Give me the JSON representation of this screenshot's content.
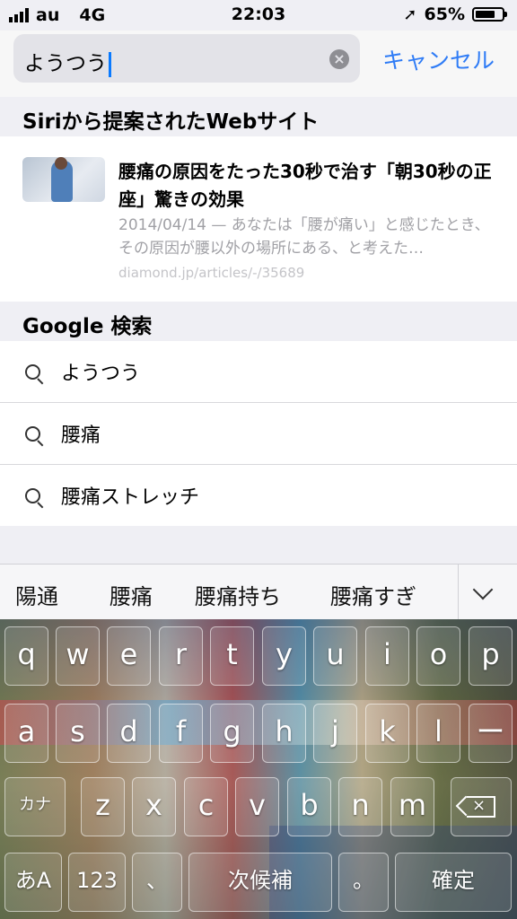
{
  "status": {
    "carrier": "au",
    "network": "4G",
    "time": "22:03",
    "battery": "65%",
    "battery_level": 0.65
  },
  "search": {
    "query": "ようつう",
    "cancel_label": "キャンセル"
  },
  "siri_section": {
    "header": "Siriから提案されたWebサイト",
    "result": {
      "title": "腰痛の原因をたった30秒で治す「朝30秒の正座」驚きの効果",
      "description": "2014/04/14 — あなたは「腰が痛い」と感じたとき、その原因が腰以外の場所にある、と考えた…",
      "url": "diamond.jp/articles/-/35689"
    }
  },
  "google_section": {
    "header": "Google 検索",
    "suggestions": [
      "ようつう",
      "腰痛",
      "腰痛ストレッチ"
    ]
  },
  "predictions": [
    "陽通",
    "腰痛",
    "腰痛持ち",
    "腰痛すぎ"
  ],
  "keyboard": {
    "row1": [
      "q",
      "w",
      "e",
      "r",
      "t",
      "y",
      "u",
      "i",
      "o",
      "p"
    ],
    "row2": [
      "a",
      "s",
      "d",
      "f",
      "g",
      "h",
      "j",
      "k",
      "l",
      "ー"
    ],
    "row3": [
      "z",
      "x",
      "c",
      "v",
      "b",
      "n",
      "m"
    ],
    "kana_label": "カナ",
    "mode_label": "あA",
    "num_label": "123",
    "comma_label": "、",
    "space_label": "次候補",
    "period_label": "。",
    "return_label": "確定"
  }
}
